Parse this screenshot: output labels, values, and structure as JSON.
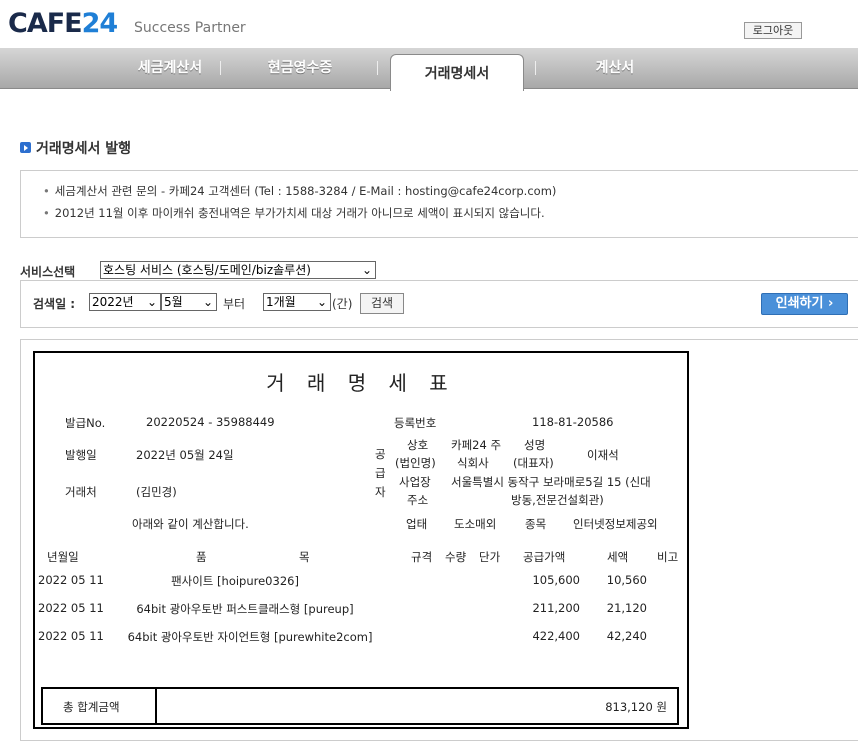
{
  "header": {
    "logo_text": "CAFE",
    "logo_num": "24",
    "partner": "Success Partner",
    "logout": "로그아웃"
  },
  "tabs": [
    "세금계산서",
    "현금영수증",
    "거래명세서",
    "계산서"
  ],
  "section": {
    "title": "거래명세서 발행",
    "notices": [
      "세금계산서 관련 문의 - 카페24 고객센터 (Tel : 1588-3284 / E-Mail : hosting@cafe24corp.com)",
      "2012년 11월 이후 마이캐쉬 충전내역은 부가가치세 대상 거래가 아니므로 세액이 표시되지 않습니다."
    ]
  },
  "service": {
    "label": "서비스선택",
    "selected": "호스팅 서비스 (호스팅/도메인/biz솔루션)"
  },
  "search": {
    "label": "검색일 :",
    "year": "2022년",
    "month": "5월",
    "from": "부터",
    "period": "1개월",
    "gan": "(간)",
    "button": "검색",
    "print": "인쇄하기 ›"
  },
  "invoice": {
    "title": "거 래 명 세 표",
    "issue_no_label": "발급No.",
    "issue_no": "20220524 - 35988449",
    "issue_date_label": "발행일",
    "issue_date": "2022년 05월 24일",
    "client_label": "거래처",
    "client": "(김민경)",
    "statement": "아래와 같이 계산합니다.",
    "reg_label": "등록번호",
    "reg_no": "118-81-20586",
    "supplier_label": [
      "공",
      "급",
      "자"
    ],
    "trade_label_1": "상호",
    "trade_label_2": "(법인명)",
    "trade_name_1": "카페24 주",
    "trade_name_2": "식회사",
    "rep_label_1": "성명",
    "rep_label_2": "(대표자)",
    "rep_name": "이재석",
    "addr_label_1": "사업장",
    "addr_label_2": "주소",
    "addr_1": "서울특별시 동작구 보라매로5길 15 (신대",
    "addr_2": "방동,전문건설회관)",
    "biz_type_label": "업태",
    "biz_type": "도소매외",
    "biz_item_label": "종목",
    "biz_item": "인터넷정보제공외",
    "columns": {
      "date": "년월일",
      "item1": "품",
      "item2": "목",
      "spec": "규격",
      "qty": "수량",
      "unit": "단가",
      "supply": "공급가액",
      "tax": "세액",
      "note": "비고"
    },
    "rows": [
      {
        "date": "2022 05 11",
        "item": "팬사이트 [hoipure0326]",
        "supply": "105,600",
        "tax": "10,560"
      },
      {
        "date": "2022 05 11",
        "item": "64bit 광아우토반 퍼스트클래스형 [pureup]",
        "supply": "211,200",
        "tax": "21,120"
      },
      {
        "date": "2022 05 11",
        "item": "64bit 광아우토반 자이언트형 [purewhite2com]",
        "supply": "422,400",
        "tax": "42,240"
      }
    ],
    "total_label": "총 합계금액",
    "total": "813,120 원"
  }
}
